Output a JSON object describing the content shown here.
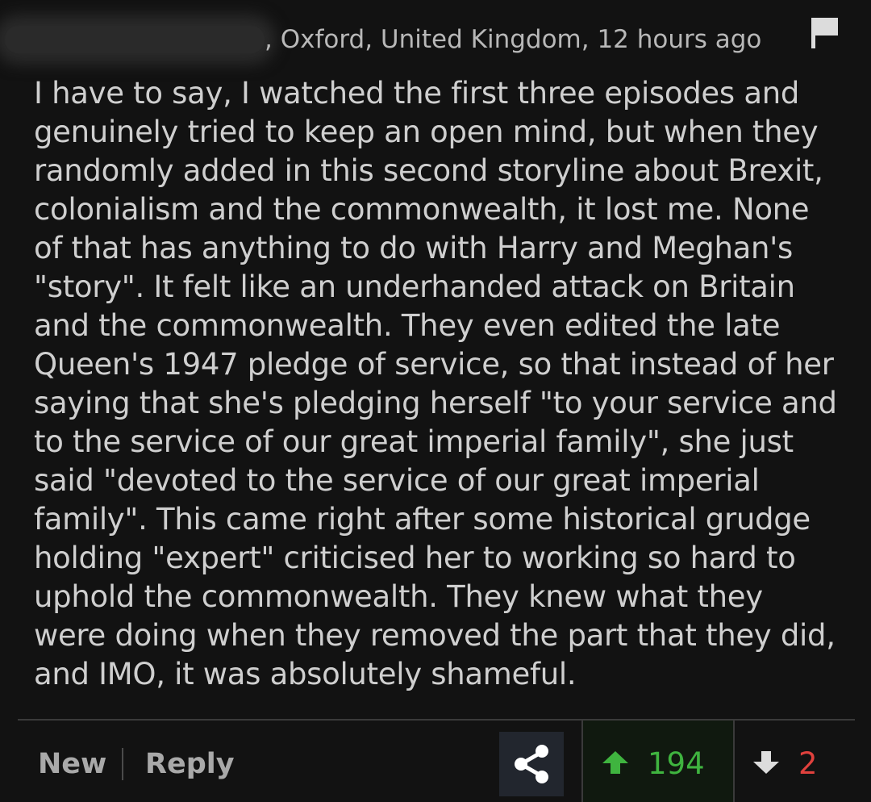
{
  "comment": {
    "author_redacted": true,
    "meta": ", Oxford, United Kingdom, 12 hours ago",
    "body": "I have to say, I watched the first three episodes and genuinely tried to keep an open mind, but when they randomly added in this second storyline about Brexit, colonialism and the commonwealth, it lost me. None of that has anything to do with Harry and Meghan's \"story\". It felt like an underhanded attack on Britain and the commonwealth. They even edited the late Queen's 1947 pledge of service, so that instead of her saying that she's pledging herself \"to your service and to the service of our great imperial family\", she just said \"devoted to the service of our great imperial family\". This came right after some historical grudge holding \"expert\" criticised her to working so hard to uphold the commonwealth. They knew what they were doing when they removed the part that they did, and IMO, it was absolutely shameful."
  },
  "footer": {
    "new_label": "New",
    "reply_label": "Reply",
    "upvotes": "194",
    "downvotes": "2"
  },
  "icons": {
    "flag": "flag-icon",
    "share": "share-icon",
    "upvote": "arrow-up-icon",
    "downvote": "arrow-down-icon"
  },
  "colors": {
    "background": "#121212",
    "upvote_green": "#3fb43f",
    "downvote_red": "#e0413d",
    "share_bg": "#22262e"
  }
}
